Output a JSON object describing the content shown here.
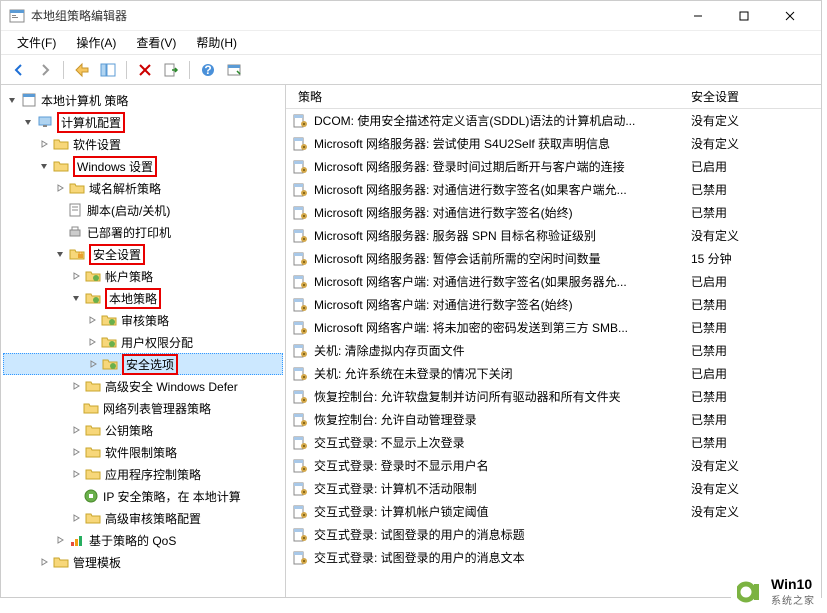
{
  "window": {
    "title": "本地组策略编辑器"
  },
  "menubar": [
    "文件(F)",
    "操作(A)",
    "查看(V)",
    "帮助(H)"
  ],
  "listheader": {
    "col1": "策略",
    "col2": "安全设置"
  },
  "tree": {
    "root": "本地计算机 策略",
    "computer_config": "计算机配置",
    "software_settings": "软件设置",
    "windows_settings": "Windows 设置",
    "dns_policy": "域名解析策略",
    "scripts": "脚本(启动/关机)",
    "deployed_printers": "已部署的打印机",
    "security_settings": "安全设置",
    "account_policy": "帐户策略",
    "local_policy": "本地策略",
    "audit_policy": "审核策略",
    "user_rights": "用户权限分配",
    "security_options": "安全选项",
    "advanced_defender": "高级安全 Windows Defer",
    "network_list": "网络列表管理器策略",
    "public_key": "公钥策略",
    "software_restriction": "软件限制策略",
    "app_control": "应用程序控制策略",
    "ip_policy": "IP 安全策略，在 本地计算",
    "advanced_audit": "高级审核策略配置",
    "qos": "基于策略的 QoS",
    "admin_templates": "管理模板"
  },
  "policies": [
    {
      "name": "DCOM: 使用安全描述符定义语言(SDDL)语法的计算机启动...",
      "value": "没有定义"
    },
    {
      "name": "Microsoft 网络服务器: 尝试使用 S4U2Self 获取声明信息",
      "value": "没有定义"
    },
    {
      "name": "Microsoft 网络服务器: 登录时间过期后断开与客户端的连接",
      "value": "已启用"
    },
    {
      "name": "Microsoft 网络服务器: 对通信进行数字签名(如果客户端允...",
      "value": "已禁用"
    },
    {
      "name": "Microsoft 网络服务器: 对通信进行数字签名(始终)",
      "value": "已禁用"
    },
    {
      "name": "Microsoft 网络服务器: 服务器 SPN 目标名称验证级别",
      "value": "没有定义"
    },
    {
      "name": "Microsoft 网络服务器: 暂停会话前所需的空闲时间数量",
      "value": "15 分钟"
    },
    {
      "name": "Microsoft 网络客户端: 对通信进行数字签名(如果服务器允...",
      "value": "已启用"
    },
    {
      "name": "Microsoft 网络客户端: 对通信进行数字签名(始终)",
      "value": "已禁用"
    },
    {
      "name": "Microsoft 网络客户端: 将未加密的密码发送到第三方 SMB...",
      "value": "已禁用"
    },
    {
      "name": "关机: 清除虚拟内存页面文件",
      "value": "已禁用"
    },
    {
      "name": "关机: 允许系统在未登录的情况下关闭",
      "value": "已启用"
    },
    {
      "name": "恢复控制台: 允许软盘复制并访问所有驱动器和所有文件夹",
      "value": "已禁用"
    },
    {
      "name": "恢复控制台: 允许自动管理登录",
      "value": "已禁用"
    },
    {
      "name": "交互式登录: 不显示上次登录",
      "value": "已禁用"
    },
    {
      "name": "交互式登录: 登录时不显示用户名",
      "value": "没有定义"
    },
    {
      "name": "交互式登录: 计算机不活动限制",
      "value": "没有定义"
    },
    {
      "name": "交互式登录: 计算机帐户锁定阈值",
      "value": "没有定义"
    },
    {
      "name": "交互式登录: 试图登录的用户的消息标题",
      "value": ""
    },
    {
      "name": "交互式登录: 试图登录的用户的消息文本",
      "value": ""
    }
  ],
  "watermark": {
    "brand": "Win10",
    "site": "系统之家"
  }
}
